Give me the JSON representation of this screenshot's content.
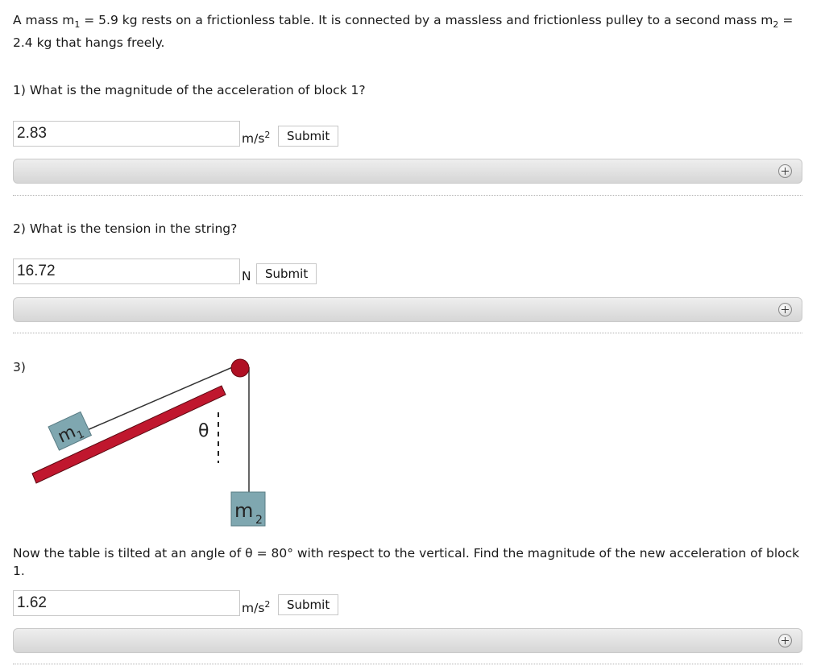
{
  "problem": {
    "intro_part1": "A mass m",
    "intro_sub1": "1",
    "intro_part2": " = 5.9 kg rests on a frictionless table. It is connected by a massless and frictionless pulley to a second mass m",
    "intro_sub2": "2",
    "intro_part3": " = 2.4 kg that hangs freely."
  },
  "questions": [
    {
      "label": "1) What is the magnitude of the acceleration of block 1?",
      "answer_value": "2.83",
      "unit_base": "m/s",
      "unit_sup": "2",
      "submit_label": "Submit"
    },
    {
      "label": "2) What is the tension in the string?",
      "answer_value": "16.72",
      "unit_base": "N",
      "unit_sup": "",
      "submit_label": "Submit"
    },
    {
      "label": "3)",
      "description": "Now the table is tilted at an angle of θ = 80° with respect to the vertical. Find the magnitude of the new acceleration of block 1.",
      "answer_value": "1.62",
      "unit_base": "m/s",
      "unit_sup": "2",
      "submit_label": "Submit"
    }
  ],
  "diagram": {
    "mass1_label": "m",
    "mass1_sub": "1",
    "mass2_label": "m",
    "mass2_sub": "2",
    "angle_label": "θ"
  },
  "colors": {
    "table": "#c0172e",
    "pulley": "#b01024",
    "block": "#7fa7b0",
    "rope": "#333333"
  },
  "icons": {
    "expand": "plus-circle-icon"
  }
}
